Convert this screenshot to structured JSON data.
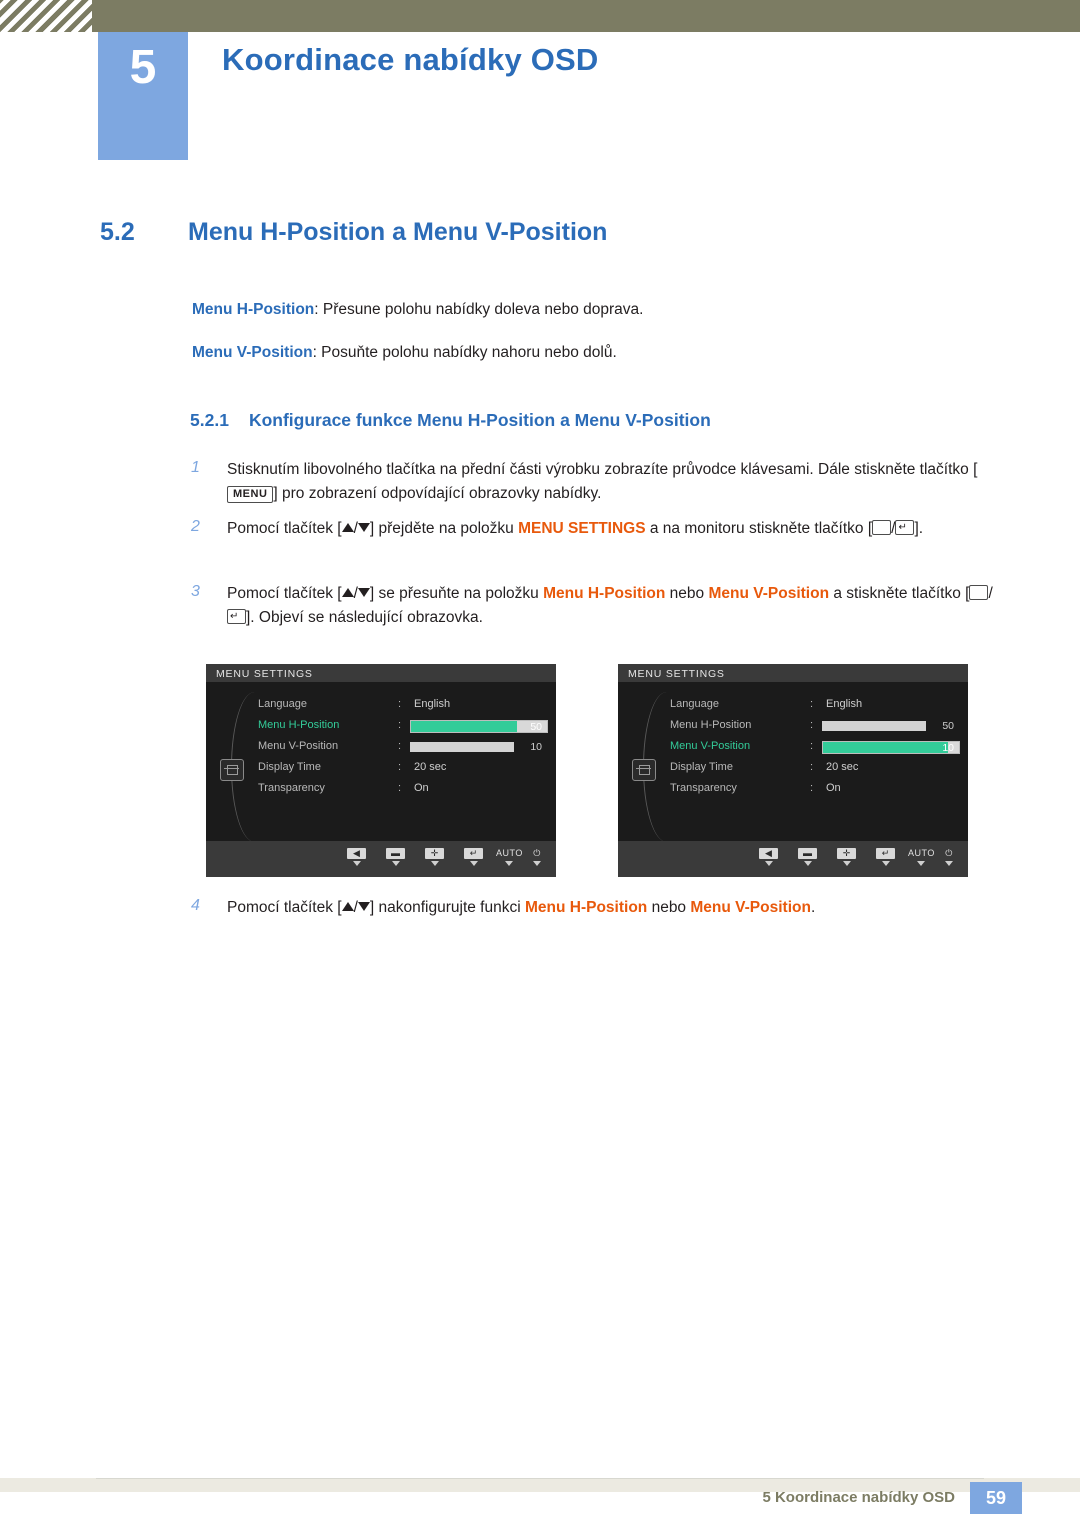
{
  "header": {
    "chapter_number": "5",
    "chapter_title": "Koordinace nabídky OSD"
  },
  "section": {
    "number": "5.2",
    "title": "Menu H-Position a Menu V-Position",
    "intro": [
      {
        "keyword": "Menu H-Position",
        "text": ": Přesune polohu nabídky doleva nebo doprava."
      },
      {
        "keyword": "Menu V-Position",
        "text": ": Posuňte polohu nabídky nahoru nebo dolů."
      }
    ],
    "subsection": {
      "number": "5.2.1",
      "title": "Konfigurace funkce Menu H-Position a Menu V-Position"
    }
  },
  "steps": {
    "s1": {
      "num": "1",
      "part1": "Stisknutím libovolného tlačítka na přední části výrobku zobrazíte průvodce klávesami. Dále stiskněte tlačítko [",
      "key": "MENU",
      "part2": "] pro zobrazení odpovídající obrazovky nabídky."
    },
    "s2": {
      "num": "2",
      "part1": "Pomocí tlačítek [",
      "part2": "] přejděte na položku ",
      "highlight": "MENU SETTINGS",
      "part3": " a na monitoru stiskněte tlačítko [",
      "part4": "]."
    },
    "s3": {
      "num": "3",
      "part1": "Pomocí tlačítek [",
      "part2": "] se přesuňte na položku ",
      "kw1": "Menu H-Position",
      "mid": " nebo ",
      "kw2": "Menu V-Position",
      "part3": " a stiskněte tlačítko [",
      "part4": "]. Objeví se následující obrazovka."
    },
    "s4": {
      "num": "4",
      "part1": "Pomocí tlačítek [",
      "part2": "] nakonfigurujte funkci ",
      "kw1": "Menu H-Position",
      "mid": " nebo ",
      "kw2": "Menu V-Position",
      "part3": "."
    }
  },
  "osd": {
    "title": "MENU SETTINGS",
    "left": {
      "rows": [
        {
          "label": "Language",
          "value": "English",
          "type": "text"
        },
        {
          "label": "Menu H-Position",
          "value": "50",
          "type": "bar_active",
          "fill_percent": 78
        },
        {
          "label": "Menu V-Position",
          "value": "10",
          "type": "bar_inactive",
          "fill_percent": 10
        },
        {
          "label": "Display Time",
          "value": "20 sec",
          "type": "text"
        },
        {
          "label": "Transparency",
          "value": "On",
          "type": "text"
        }
      ],
      "selected_index": 1
    },
    "right": {
      "rows": [
        {
          "label": "Language",
          "value": "English",
          "type": "text"
        },
        {
          "label": "Menu H-Position",
          "value": "50",
          "type": "bar_inactive",
          "fill_percent": 50
        },
        {
          "label": "Menu V-Position",
          "value": "10",
          "type": "bar_active",
          "fill_percent": 92
        },
        {
          "label": "Display Time",
          "value": "20 sec",
          "type": "text"
        },
        {
          "label": "Transparency",
          "value": "On",
          "type": "text"
        }
      ],
      "selected_index": 2
    },
    "buttons": [
      {
        "glyph": "◀",
        "label": ""
      },
      {
        "glyph": "▬",
        "label": ""
      },
      {
        "glyph": "✛",
        "label": ""
      },
      {
        "glyph": "↵",
        "label": ""
      },
      {
        "glyph": "",
        "label": "AUTO"
      },
      {
        "glyph": "",
        "label": "⏻"
      }
    ]
  },
  "footer": {
    "text": "5 Koordinace nabídky OSD",
    "page": "59"
  }
}
